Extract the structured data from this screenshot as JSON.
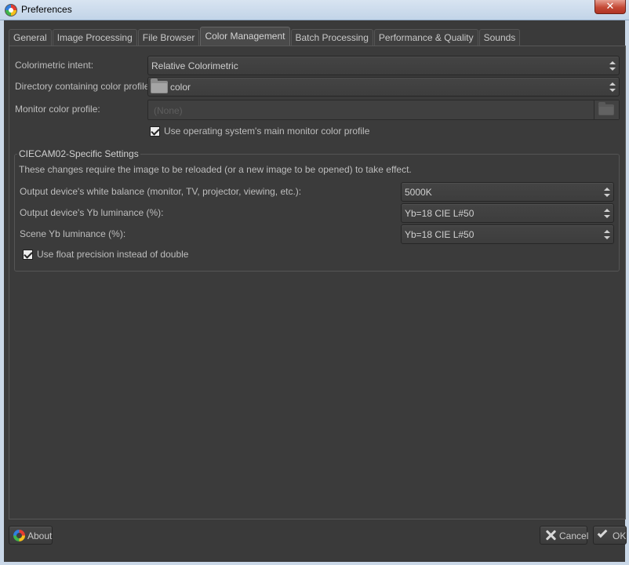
{
  "window": {
    "title": "Preferences",
    "close_glyph": "✕"
  },
  "tabs": [
    {
      "label": "General"
    },
    {
      "label": "Image Processing"
    },
    {
      "label": "File Browser"
    },
    {
      "label": "Color Management"
    },
    {
      "label": "Batch Processing"
    },
    {
      "label": "Performance & Quality"
    },
    {
      "label": "Sounds"
    }
  ],
  "active_tab": "Color Management",
  "color_management": {
    "intent_label": "Colorimetric intent:",
    "intent_value": "Relative Colorimetric",
    "dir_label": "Directory containing color profiles:",
    "dir_value": "color",
    "monitor_label": "Monitor color profile:",
    "monitor_value": "(None)",
    "use_os_label": "Use operating system's main monitor color profile",
    "use_os_checked": true
  },
  "ciecam": {
    "title": "CIECAM02-Specific Settings",
    "note": "These changes require the image to be reloaded (or a new image to be opened) to take effect.",
    "wb_label": "Output device's white balance (monitor, TV, projector, viewing, etc.):",
    "wb_value": "5000K",
    "yb_out_label": "Output device's Yb luminance (%):",
    "yb_out_value": "Yb=18 CIE L#50",
    "yb_scene_label": "Scene Yb luminance (%):",
    "yb_scene_value": "Yb=18 CIE L#50",
    "float_label": "Use float precision instead of double",
    "float_checked": true
  },
  "buttons": {
    "about": "About",
    "cancel": "Cancel",
    "ok": "OK"
  }
}
